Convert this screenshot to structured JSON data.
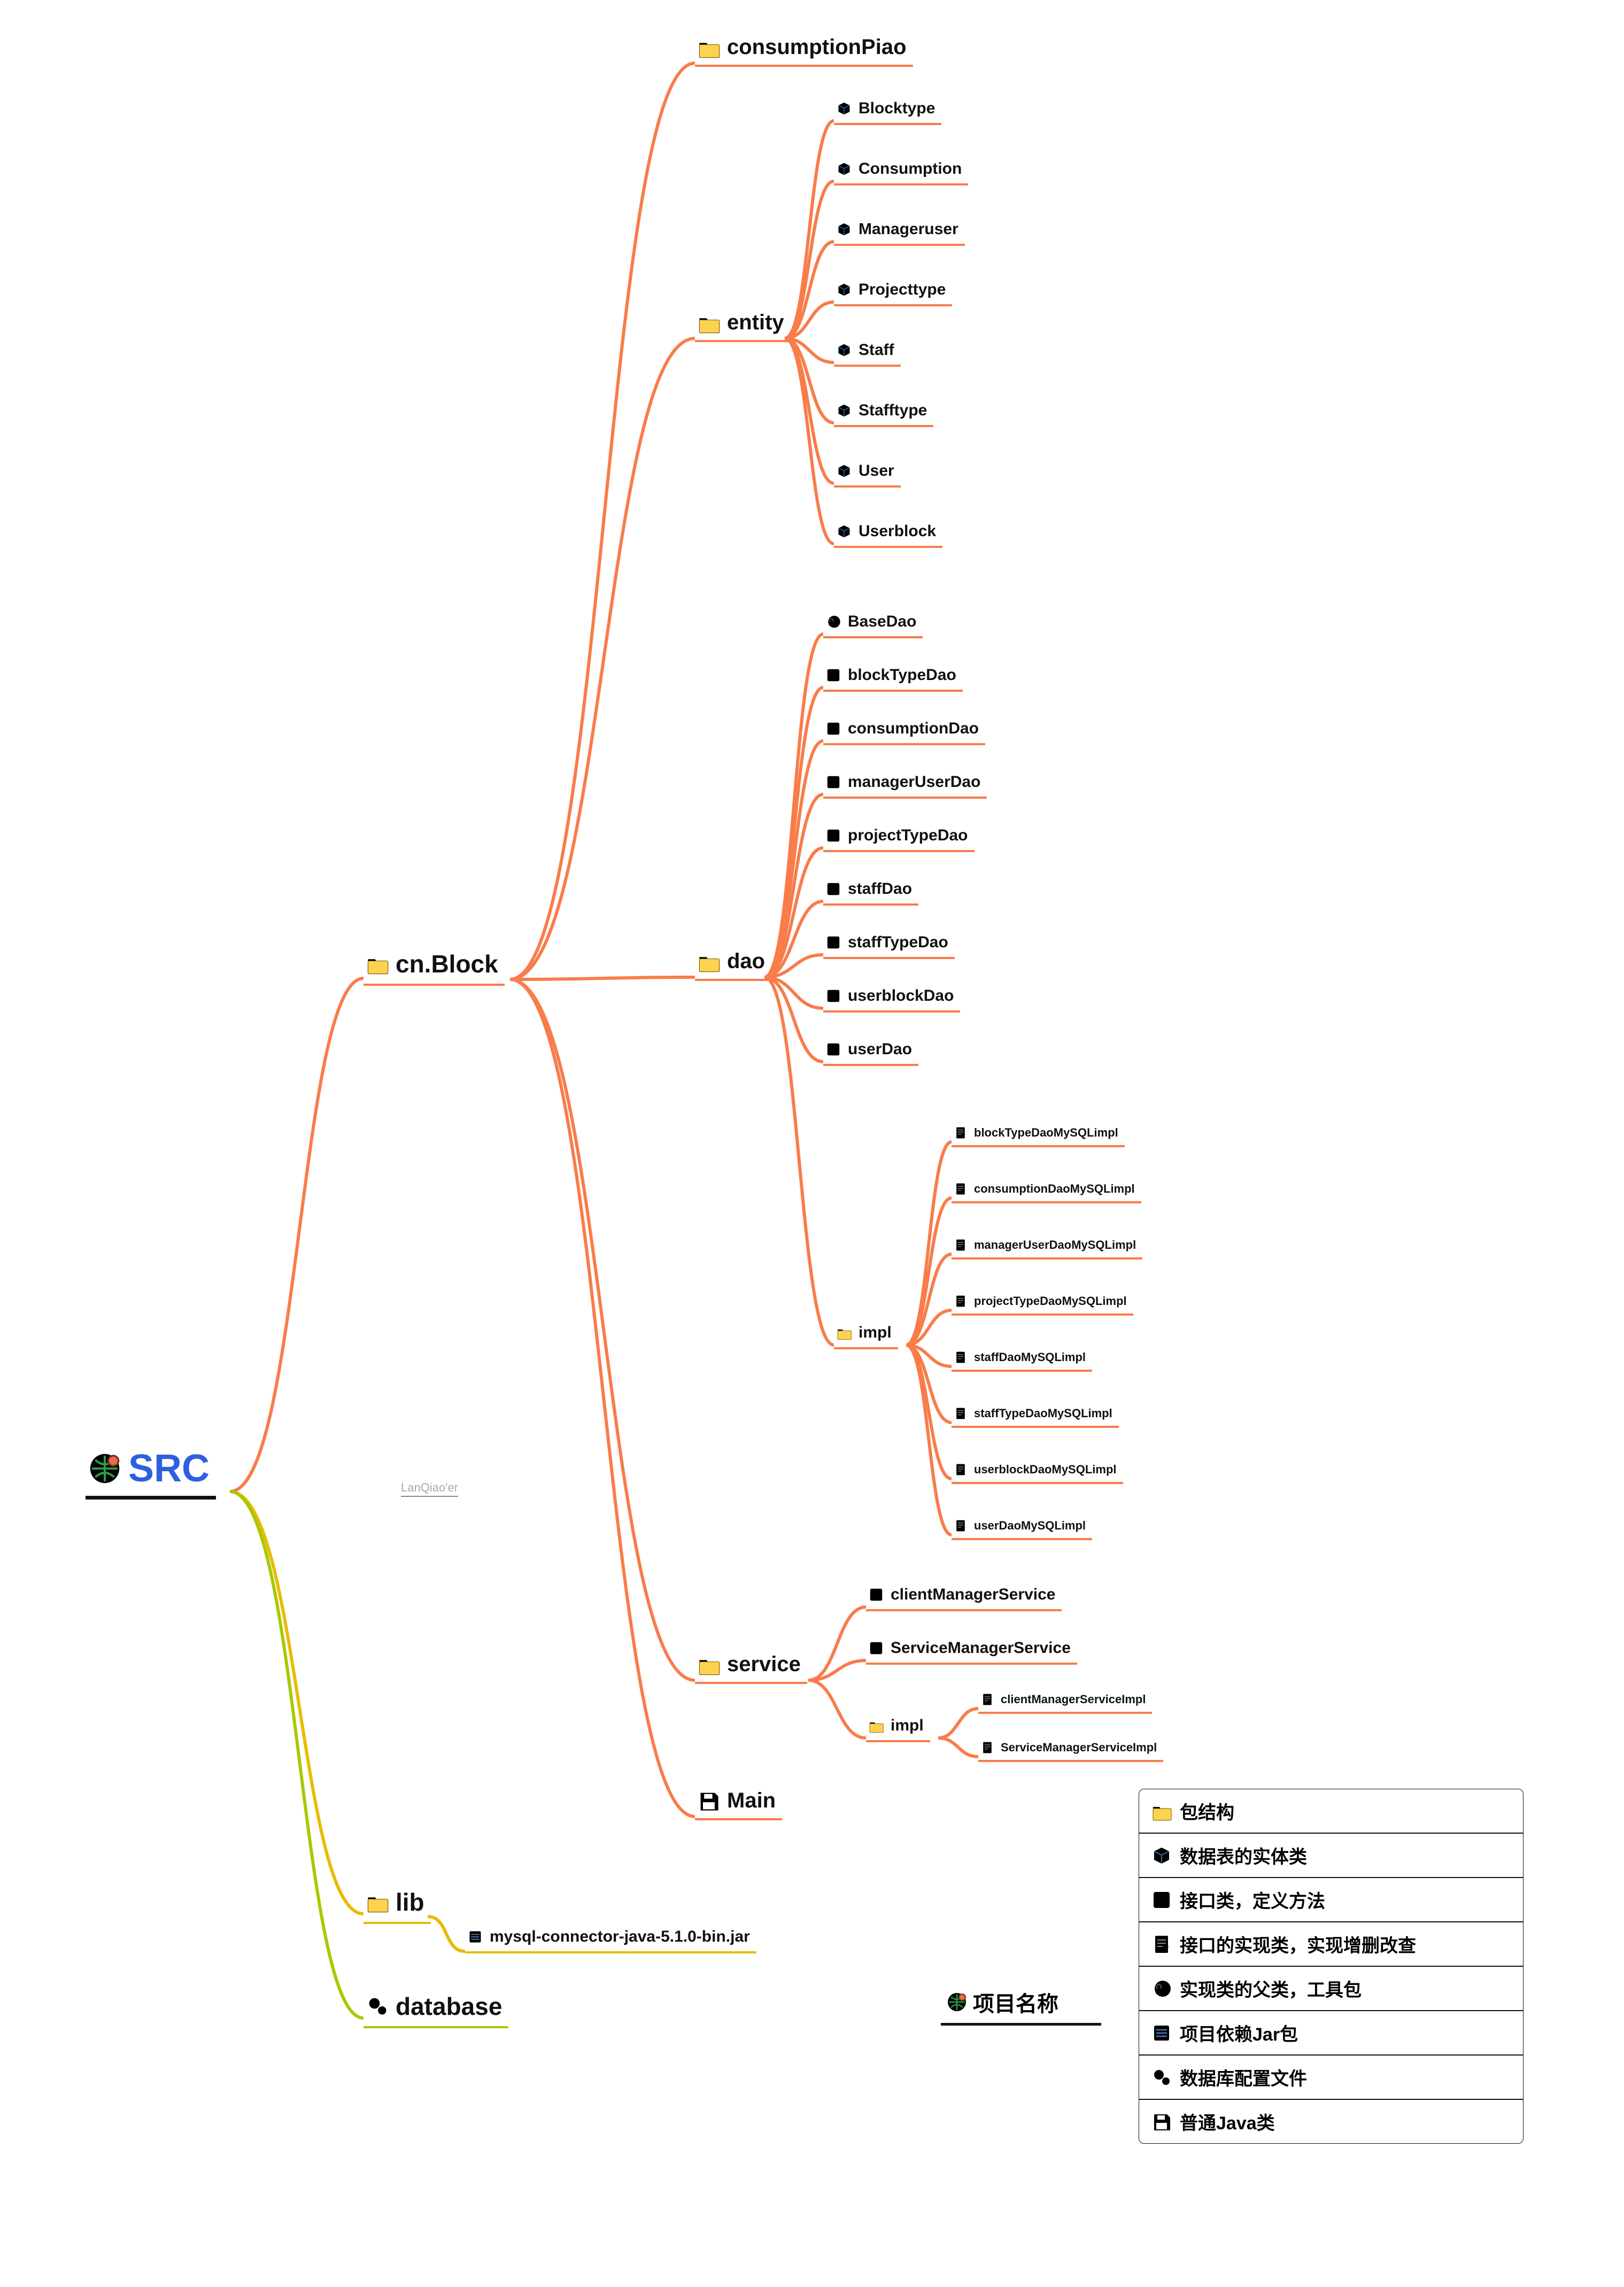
{
  "root": {
    "label": "SRC"
  },
  "watermark": "LanQiao'er",
  "cn_block": {
    "label": "cn.Block"
  },
  "lib": {
    "label": "lib",
    "jar": "mysql-connector-java-5.1.0-bin.jar"
  },
  "database": {
    "label": "database"
  },
  "consumptionPiao": {
    "label": "consumptionPiao"
  },
  "entity": {
    "label": "entity",
    "items": [
      "Blocktype",
      "Consumption",
      "Manageruser",
      "Projecttype",
      "Staff",
      "Stafftype",
      "User",
      "Userblock"
    ]
  },
  "dao": {
    "label": "dao",
    "base": "BaseDao",
    "items": [
      "blockTypeDao",
      "consumptionDao",
      "managerUserDao",
      "projectTypeDao",
      "staffDao",
      "staffTypeDao",
      "userblockDao",
      "userDao"
    ],
    "impl": {
      "label": "impl",
      "items": [
        "blockTypeDaoMySQLimpl",
        "consumptionDaoMySQLimpl",
        "managerUserDaoMySQLimpl",
        "projectTypeDaoMySQLimpl",
        "staffDaoMySQLimpl",
        "staffTypeDaoMySQLimpl",
        "userblockDaoMySQLimpl",
        "userDaoMySQLimpl"
      ]
    }
  },
  "service": {
    "label": "service",
    "items": [
      "clientManagerService",
      "ServiceManagerService"
    ],
    "impl": {
      "label": "impl",
      "items": [
        "clientManagerServiceImpl",
        "ServiceManagerServiceImpl"
      ]
    }
  },
  "main": {
    "label": "Main"
  },
  "legend": {
    "title": "项目名称",
    "items": [
      {
        "icon": "folder",
        "text": "包结构"
      },
      {
        "icon": "cube",
        "text": "数据表的实体类"
      },
      {
        "icon": "iface",
        "text": "接口类，定义方法"
      },
      {
        "icon": "doc",
        "text": "接口的实现类，实现增删改查"
      },
      {
        "icon": "moon",
        "text": "实现类的父类，工具包"
      },
      {
        "icon": "jar",
        "text": "项目依赖Jar包"
      },
      {
        "icon": "gears",
        "text": "数据库配置文件"
      },
      {
        "icon": "floppy",
        "text": "普通Java类"
      }
    ]
  }
}
